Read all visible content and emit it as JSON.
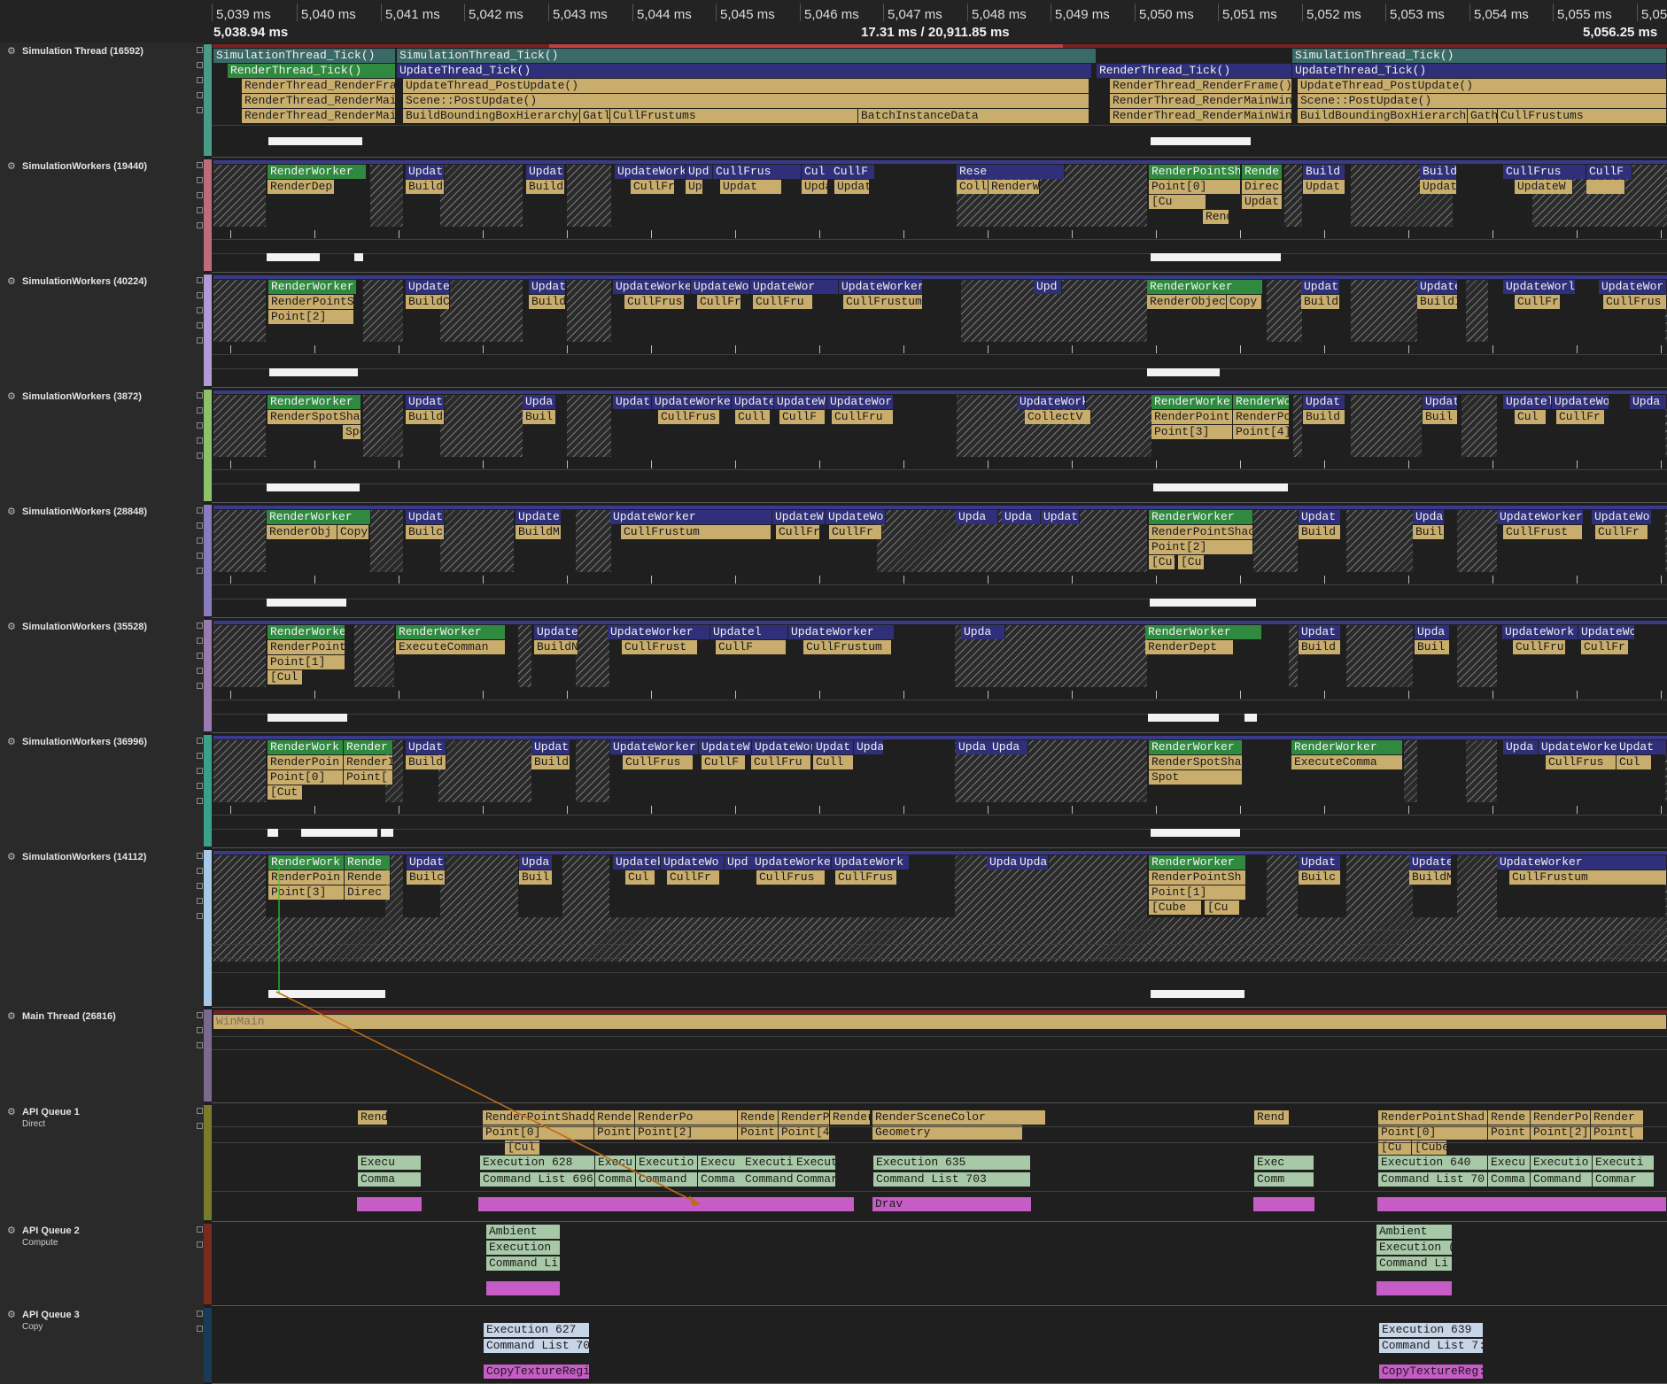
{
  "ruler": {
    "ticks": [
      "5,039 ms",
      "5,040 ms",
      "5,041 ms",
      "5,042 ms",
      "5,043 ms",
      "5,044 ms",
      "5,045 ms",
      "5,046 ms",
      "5,047 ms",
      "5,048 ms",
      "5,049 ms",
      "5,050 ms",
      "5,051 ms",
      "5,052 ms",
      "5,053 ms",
      "5,054 ms",
      "5,055 ms",
      "5,05"
    ],
    "range_start": "5,038.94 ms",
    "range_duration": "17.31 ms / 20,911.85 ms",
    "range_end": "5,056.25 ms"
  },
  "threads": [
    {
      "name": "Simulation Thread (16592)",
      "sub": "",
      "color": "#4a9a88"
    },
    {
      "name": "SimulationWorkers (19440)",
      "sub": "",
      "color": "#c06b7a"
    },
    {
      "name": "SimulationWorkers (40224)",
      "sub": "",
      "color": "#b29ad8"
    },
    {
      "name": "SimulationWorkers (3872)",
      "sub": "",
      "color": "#8fc06a"
    },
    {
      "name": "SimulationWorkers (28848)",
      "sub": "",
      "color": "#8a7bc0"
    },
    {
      "name": "SimulationWorkers (35528)",
      "sub": "",
      "color": "#9a7ab0"
    },
    {
      "name": "SimulationWorkers (36996)",
      "sub": "",
      "color": "#3aa088"
    },
    {
      "name": "SimulationWorkers (14112)",
      "sub": "",
      "color": "#a8c8e8"
    },
    {
      "name": "Main Thread (26816)",
      "sub": "",
      "color": "#7a6a90"
    },
    {
      "name": "API Queue 1",
      "sub": "Direct",
      "color": "#7a7a2a"
    },
    {
      "name": "API Queue 2",
      "sub": "Compute",
      "color": "#7a2a1a"
    },
    {
      "name": "API Queue 3",
      "sub": "Copy",
      "color": "#1a3a5a"
    }
  ],
  "events": {
    "sim": [
      "SimulationThread_Tick()",
      "SimulationThread_Tick()",
      "SimulationThread_Tick()",
      "RenderThread_Tick()",
      "UpdateThread_Tick()",
      "RenderThread_Tick()",
      "UpdateThread_Tick()",
      "RenderThread_RenderFra",
      "UpdateThread_PostUpdate()",
      "RenderThread_RenderFrame()",
      "UpdateThread_PostUpdate()",
      "RenderThread_RenderMai",
      "Scene::PostUpdate()",
      "RenderThread_RenderMainWin",
      "Scene::PostUpdate()",
      "RenderThread_RenderMai",
      "BuildBoundingBoxHierarchy",
      "Gatl",
      "CullFrustums",
      "BatchInstanceData",
      "RenderThread_RenderMainWin",
      "BuildBoundingBoxHierarch",
      "Gath",
      "CullFrustums"
    ],
    "w19440": [
      "RenderWorker",
      "RenderDep",
      "Updat",
      "Build",
      "Updat",
      "Build",
      "UpdateWork",
      "CullFr",
      "Upd",
      "UpdateWorke",
      "CullFrus",
      "Updat",
      "Cul",
      "Updat",
      "CullF",
      "UpdateWorker",
      "Rese",
      "Collect",
      "RenderWorker",
      "RenderPointSh",
      "Point[0]",
      "[Cu",
      "Rende",
      "Rende",
      "Direc",
      "Updat",
      "Build",
      "Updat",
      "Build",
      "UpdateWorker",
      "CullFrus",
      "UpdateW",
      "CullF"
    ],
    "w40224": [
      "RenderWorker",
      "RenderPointS",
      "Point[2]",
      "Update",
      "BuildC",
      "Updat",
      "Build",
      "UpdateWorke",
      "CullFrus",
      "UpdateWo",
      "CullFr",
      "UpdateWor",
      "CullFru",
      "UpdateWorker",
      "CullFrustum",
      "Upd",
      "RenderWorker",
      "RenderObjec",
      "Copy",
      "Updat",
      "Build",
      "Update",
      "BuildI",
      "UpdateWorl",
      "CullFr",
      "UpdateWor",
      "CullFrus"
    ],
    "w3872": [
      "RenderWorker",
      "RenderSpotSha",
      "Spot",
      "Updat",
      "Build",
      "Upda",
      "Buil",
      "Updat",
      "UpdateWorke",
      "CullFrus",
      "Update",
      "Cull",
      "UpdateW",
      "CullF",
      "UpdateWor",
      "CullFru",
      "UpdateWork",
      "CollectV",
      "RenderWorke",
      "RenderPoint",
      "Point[3]",
      "RenderWo",
      "RenderPo",
      "Point[4]",
      "Updat",
      "Build",
      "Updat",
      "Buil",
      "Updatel",
      "Cul",
      "UpdateWo",
      "CullFr",
      "Upda"
    ],
    "w28848": [
      "RenderWorker",
      "RenderObj",
      "Copy",
      "Updat",
      "Builc",
      "Update",
      "BuildM",
      "UpdateWorker",
      "CullFrustum",
      "UpdateW",
      "CullFr",
      "UpdateWo",
      "CullFr",
      "Upda",
      "Upda",
      "Updat",
      "RenderWorker",
      "RenderPointShac",
      "Point[2]",
      "[Cul",
      "[Cu",
      "Updat",
      "Build",
      "Upda",
      "Buil",
      "UpdateWorker",
      "CullFrust",
      "UpdateWo",
      "CullFr"
    ],
    "w35528": [
      "RenderWorker",
      "RenderPoint",
      "Point[1]",
      "[Cul",
      "RenderWorker",
      "ExecuteComman",
      "Update",
      "BuildN",
      "UpdateWorker",
      "CullFrust",
      "Updatel",
      "CullF",
      "UpdateWorker",
      "CullFrustum",
      "Upda",
      "RenderWorker",
      "RenderDept",
      "Updat",
      "Build",
      "Upda",
      "Buil",
      "UpdateWork",
      "CullFru",
      "UpdateWo",
      "CullFr"
    ],
    "w36996": [
      "RenderWork",
      "RenderPoin",
      "Point[0]",
      "[Cut",
      "Render",
      "RenderI",
      "Point[",
      "Updat",
      "Build",
      "Updat",
      "BuildI",
      "UpdateWorker",
      "CullFrus",
      "UpdateW",
      "CullF",
      "UpdateWor",
      "CullFru",
      "Updat",
      "Cull",
      "Upda",
      "Upda",
      "Upda",
      "RenderWorker",
      "RenderSpotShad",
      "Spot",
      "RenderWorker",
      "ExecuteComma",
      "Upda",
      "UpdateWorke",
      "CullFrus",
      "Updat",
      "Cul"
    ],
    "w14112": [
      "RenderWork",
      "RenderPoin",
      "Point[3]",
      "Rende",
      "Rende",
      "Direc",
      "Updat",
      "Builc",
      "Upda",
      "Buil",
      "Updatek",
      "Cul",
      "UpdateWo",
      "CullFr",
      "Upd",
      "UpdateWorke",
      "CullFrus",
      "UpdateWork",
      "CullFrus",
      "Upda",
      "Upda",
      "RenderWorker",
      "RenderPointSh",
      "Point[1]",
      "[Cube",
      "[Cu",
      "Updat",
      "Builc",
      "Update",
      "BuildM",
      "UpdateWorker",
      "CullFrustum"
    ],
    "main": [
      "WinMain"
    ],
    "q1": [
      "Rend",
      "RenderPointShado",
      "Point[0]",
      "[Cul",
      "Rende",
      "Point",
      "RenderPo",
      "Point[2]",
      "Rende",
      "Point",
      "RenderP",
      "Point[4",
      "Render",
      "RenderSceneColor",
      "Geometry",
      "Rend",
      "RenderPointShad",
      "Point[0]",
      "[Cu",
      "[Cube",
      "Rende",
      "Point",
      "RenderPo",
      "Point[2]",
      "Render",
      "Point[",
      "Execu",
      "Comma",
      "Execution 628",
      "Command List 696",
      "Execu",
      "Comma",
      "Executio",
      "Command",
      "Execu",
      "Comma",
      "Executi",
      "Command",
      "Execut",
      "Commar",
      "Execution 635",
      "Command List 703",
      "Exec",
      "Comm",
      "Execution 640",
      "Command List 70",
      "Execu",
      "Comma",
      "Executio",
      "Command",
      "Executi",
      "Commar",
      "Drav"
    ],
    "q2": [
      "Ambient",
      "Execution",
      "Command Li",
      "Ambient",
      "Execution (",
      "Command Li"
    ],
    "q3": [
      "Execution 627",
      "Command List 70",
      "CopyTextureRegi",
      "Execution 639",
      "Command List 7:",
      "CopyTextureReg:"
    ]
  }
}
